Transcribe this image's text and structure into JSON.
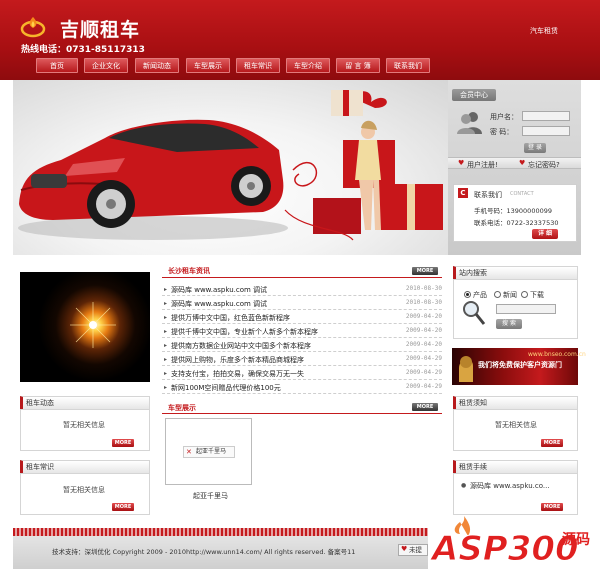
{
  "header": {
    "site_name": "吉顺租车",
    "hotline": "热线电话：0731-85117313",
    "top_link": "汽车租赁"
  },
  "nav": [
    {
      "label": "首页"
    },
    {
      "label": "企业文化"
    },
    {
      "label": "新闻动态"
    },
    {
      "label": "车型展示"
    },
    {
      "label": "租车常识"
    },
    {
      "label": "车型介绍"
    },
    {
      "label": "留 言 簿"
    },
    {
      "label": "联系我们"
    }
  ],
  "member": {
    "title": "会员中心",
    "username_label": "用户名：",
    "password_label": "密  码：",
    "login_label": "登 录",
    "register_label": "用户注册!",
    "forgot_label": "忘记密码?"
  },
  "contact": {
    "title": "联系我们",
    "subtitle": "CONTACT",
    "mobile": "手机号码：13900000099",
    "phone": "联系电话：0722-32337530",
    "details_label": "详 细"
  },
  "news": {
    "title": "长沙租车资讯",
    "more_label": "MORE",
    "items": [
      {
        "title": "源码库   www.aspku.com 调试",
        "date": "2010-08-30"
      },
      {
        "title": "源码库   www.aspku.com 调试",
        "date": "2010-08-30"
      },
      {
        "title": "提供万博中文中国，红色蓝色新新程序",
        "date": "2009-04-20"
      },
      {
        "title": "提供千博中文中国，专业新个人新多个新本程序",
        "date": "2009-04-20"
      },
      {
        "title": "提供南方数据企业网站中文中国多个新本程序",
        "date": "2009-04-20"
      },
      {
        "title": "提供网上购物，乐度多个新本精品商城程序",
        "date": "2009-04-29"
      },
      {
        "title": "支持支付宝，拍拍交易，确保交易万无一失",
        "date": "2009-04-29"
      },
      {
        "title": "新网100M空间赠品代理价格100元",
        "date": "2009-04-29"
      }
    ]
  },
  "cars": {
    "title": "车型展示",
    "more_label": "MORE",
    "item_alt": "起亚千里马",
    "item_caption": "起亚千里马"
  },
  "left": {
    "rental_news_title": "租车动态",
    "rental_news_empty": "暂无相关信息",
    "rental_tips_title": "租车常识",
    "rental_tips_empty": "暂无相关信息",
    "more_label": "MORE"
  },
  "right": {
    "search_title": "站内搜索",
    "search_options": [
      "产品",
      "新闻",
      "下载"
    ],
    "search_button": "搜 索",
    "ad_domain": "www.bnseo.com.cn",
    "ad_text": "我们将免费保护客户资源门",
    "rental_notice_title": "租赁须知",
    "rental_notice_empty": "暂无相关信息",
    "rental_process_title": "租赁手续",
    "rental_process_item": "源码库   www.aspku.co...",
    "more_label": "MORE"
  },
  "footer": {
    "text": "技术支持：深圳优化 Copyright 2009 - 2010http://www.unn14.com/ All rights reserved. 备案号11",
    "favorite_label": "未提"
  },
  "watermark": {
    "brand": "ASP300",
    "suffix": "源码"
  },
  "colors": {
    "brand_red": "#c41a1d",
    "dark_red": "#8e0b0e",
    "panel_gray": "#d4d4d4"
  }
}
